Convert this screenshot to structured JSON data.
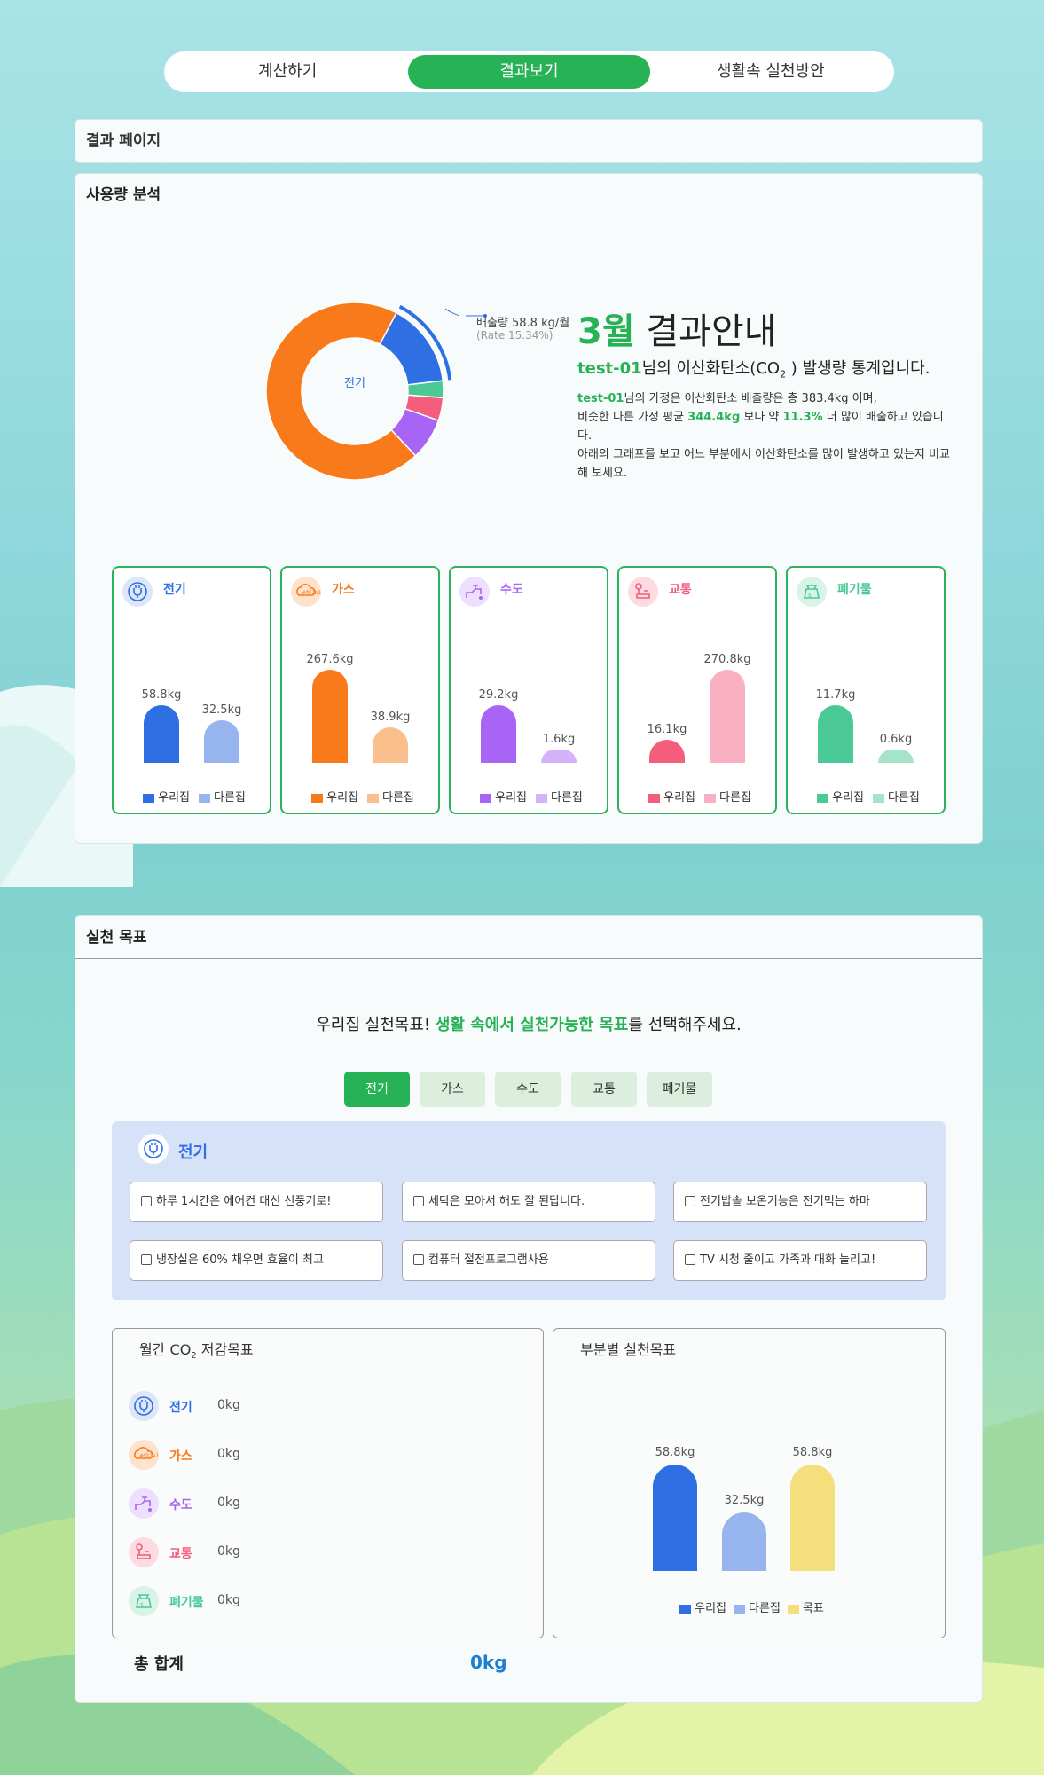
{
  "top_tabs": {
    "calc": "계산하기",
    "result": "결과보기",
    "practice": "생활속 실천방안"
  },
  "result_panel": {
    "title": "결과 페이지"
  },
  "usage": {
    "title": "사용량 분석",
    "donut_center": "전기",
    "callout_main": "배출량 58.8 kg/월",
    "callout_rate": "(Rate 15.34%)",
    "headline_month": "3월",
    "headline_rest": " 결과안내",
    "sub_user": "test-01",
    "sub_text": "님의 이산화탄소(CO",
    "sub_sub": "2",
    "sub_tail": "  ) 발생량 통계입니다.",
    "p_user": "test-01",
    "p1": "님의 가정은 이산화탄소 배출량은 총 383.4kg 이며,",
    "p2a": "비슷한 다른 가정 평균 ",
    "p2b": "344.4kg",
    "p2c": " 보다 약 ",
    "p2d": "11.3%",
    "p2e": " 더 많이 배출하고 있습니다.",
    "p3": "아래의 그래프를 보고 어느 부분에서 이산화탄소를 많이 발생하고 있는지 비교해 보세요."
  },
  "colors": {
    "electric": "#2f6fe4",
    "gas": "#f97a1a",
    "water": "#a865f5",
    "transport": "#f45d7b",
    "waste": "#4ac997",
    "brand": "#27b255"
  },
  "legend": {
    "mine": "우리집",
    "other": "다른집",
    "goal": "목표"
  },
  "categories": [
    {
      "name": "전기",
      "icon": "plug-icon",
      "mine_label": "58.8kg",
      "other_label": "32.5kg",
      "mine": 58.8,
      "other": 32.5
    },
    {
      "name": "가스",
      "icon": "co2-cloud-icon",
      "mine_label": "267.6kg",
      "other_label": "38.9kg",
      "mine": 267.6,
      "other": 38.9
    },
    {
      "name": "수도",
      "icon": "faucet-icon",
      "mine_label": "29.2kg",
      "other_label": "1.6kg",
      "mine": 29.2,
      "other": 1.6
    },
    {
      "name": "교통",
      "icon": "car-icon",
      "mine_label": "16.1kg",
      "other_label": "270.8kg",
      "mine": 16.1,
      "other": 270.8
    },
    {
      "name": "폐기물",
      "icon": "trash-bag-icon",
      "mine_label": "11.7kg",
      "other_label": "0.6kg",
      "mine": 11.7,
      "other": 0.6
    }
  ],
  "chart_data": [
    {
      "type": "pie",
      "title": "",
      "categories": [
        "전기",
        "수도",
        "교통",
        "폐기물",
        "가스"
      ],
      "values": [
        58.8,
        29.2,
        16.1,
        11.7,
        267.6
      ],
      "highlight": "전기"
    },
    {
      "type": "bar",
      "title": "전기",
      "categories": [
        "우리집",
        "다른집"
      ],
      "values": [
        58.8,
        32.5
      ]
    },
    {
      "type": "bar",
      "title": "가스",
      "categories": [
        "우리집",
        "다른집"
      ],
      "values": [
        267.6,
        38.9
      ]
    },
    {
      "type": "bar",
      "title": "수도",
      "categories": [
        "우리집",
        "다른집"
      ],
      "values": [
        29.2,
        1.6
      ]
    },
    {
      "type": "bar",
      "title": "교통",
      "categories": [
        "우리집",
        "다른집"
      ],
      "values": [
        16.1,
        270.8
      ]
    },
    {
      "type": "bar",
      "title": "폐기물",
      "categories": [
        "우리집",
        "다른집"
      ],
      "values": [
        11.7,
        0.6
      ]
    },
    {
      "type": "bar",
      "title": "부분별 실천목표",
      "categories": [
        "우리집",
        "다른집",
        "목표"
      ],
      "values": [
        58.8,
        32.5,
        58.8
      ]
    }
  ],
  "practice": {
    "title": "실천 목표",
    "prompt_a": "우리집 실천목표! ",
    "prompt_b": "생활 속에서 실천가능한 목표",
    "prompt_c": "를 선택해주세요.",
    "tabs": [
      "전기",
      "가스",
      "수도",
      "교통",
      "폐기물"
    ],
    "section_title": "전기",
    "checks": [
      "하루 1시간은 에어컨 대신 선풍기로!",
      "세탁은 모아서 해도 잘 된답니다.",
      "전기밥솥 보온기능은 전기먹는 하마",
      "냉장실은 60% 채우면 효율이 최고",
      "컴퓨터 절전프로그램사용",
      "TV 시청 줄이고 가족과 대화 늘리고!"
    ],
    "monthly_title_a": "월간 CO",
    "monthly_title_sub": "2",
    "monthly_title_b": "  저감목표",
    "monthly_rows": [
      {
        "name": "전기",
        "value": "0kg"
      },
      {
        "name": "가스",
        "value": "0kg"
      },
      {
        "name": "수도",
        "value": "0kg"
      },
      {
        "name": "교통",
        "value": "0kg"
      },
      {
        "name": "폐기물",
        "value": "0kg"
      }
    ],
    "part_title": "부분별 실천목표",
    "part_labels": [
      "58.8kg",
      "32.5kg",
      "58.8kg"
    ],
    "total_label": "총 합계",
    "total_value": "0kg"
  }
}
